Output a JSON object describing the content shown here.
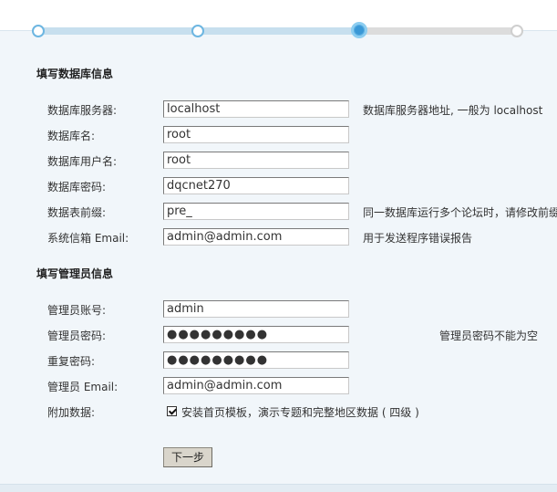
{
  "progress": {
    "steps_total": 4,
    "current_step": 3
  },
  "db_section": {
    "title": "填写数据库信息",
    "fields": [
      {
        "label": "数据库服务器:",
        "value": "localhost",
        "hint": "数据库服务器地址, 一般为  localhost"
      },
      {
        "label": "数据库名:",
        "value": "root",
        "hint": ""
      },
      {
        "label": "数据库用户名:",
        "value": "root",
        "hint": ""
      },
      {
        "label": "数据库密码:",
        "value": "dqcnet270",
        "hint": ""
      },
      {
        "label": "数据表前缀:",
        "value": "pre_",
        "hint": "同一数据库运行多个论坛时，请修改前缀"
      },
      {
        "label": "系统信箱  Email:",
        "value": "admin@admin.com",
        "hint": "用于发送程序错误报告"
      }
    ]
  },
  "admin_section": {
    "title": "填写管理员信息",
    "fields": [
      {
        "label": "管理员账号:",
        "value": "admin",
        "hint": ""
      },
      {
        "label": "管理员密码:",
        "value": "●●●●●●●●●",
        "hint": "管理员密码不能为空"
      },
      {
        "label": "重复密码:",
        "value": "●●●●●●●●●",
        "hint": ""
      },
      {
        "label": "管理员  Email:",
        "value": "admin@admin.com",
        "hint": ""
      }
    ]
  },
  "extra": {
    "label": "附加数据:",
    "checkbox_label": "安装首页模板，演示专题和完整地区数据 ( 四级 )",
    "checked": true
  },
  "next_button": "下一步",
  "colors": {
    "page_bg": "#f1f6fa",
    "step_ring": "#7fbce0",
    "step_current": "#3a98d6",
    "track": "#dcdcdc"
  }
}
